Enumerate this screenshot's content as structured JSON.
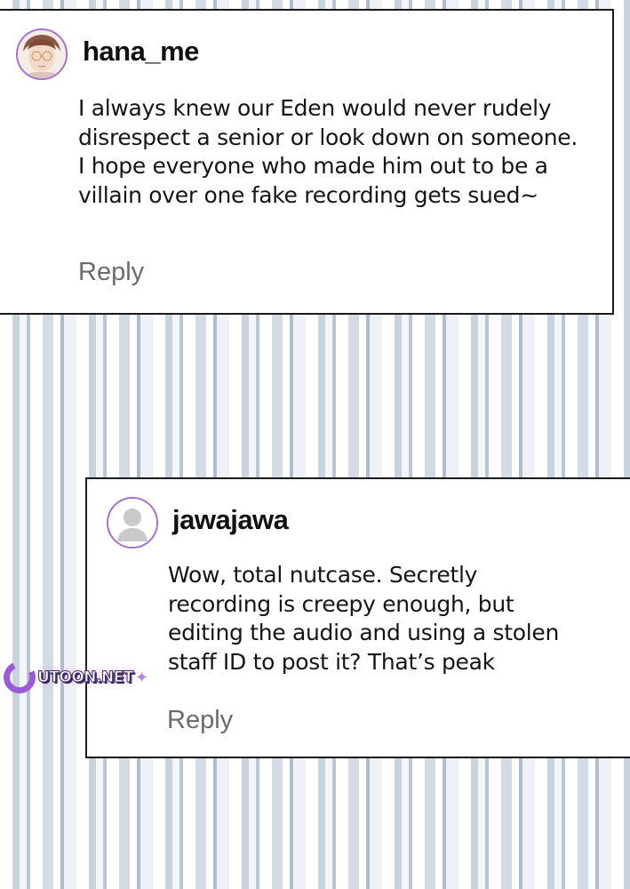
{
  "comments": [
    {
      "username": "hana_me",
      "text": "I always knew our Eden would never rudely\ndisrespect a senior or look down on someone.\nI hope everyone who made him out to be a\nvillain over one fake recording gets sued~",
      "reply_label": "Reply",
      "avatar_icon": "profile-photo"
    },
    {
      "username": "jawajawa",
      "text": "Wow, total nutcase. Secretly\nrecording is creepy enough, but\nediting the audio and using a stolen\nstaff ID to post it? That’s peak",
      "reply_label": "Reply",
      "avatar_icon": "default-user-icon"
    }
  ],
  "watermark": {
    "text": "UTOON.NET"
  },
  "colors": {
    "avatar_ring": "#a36fd1",
    "reply_text": "#6b6b6b",
    "stripe_light": "#ffffff",
    "stripe_blue": "#c8d3de"
  }
}
